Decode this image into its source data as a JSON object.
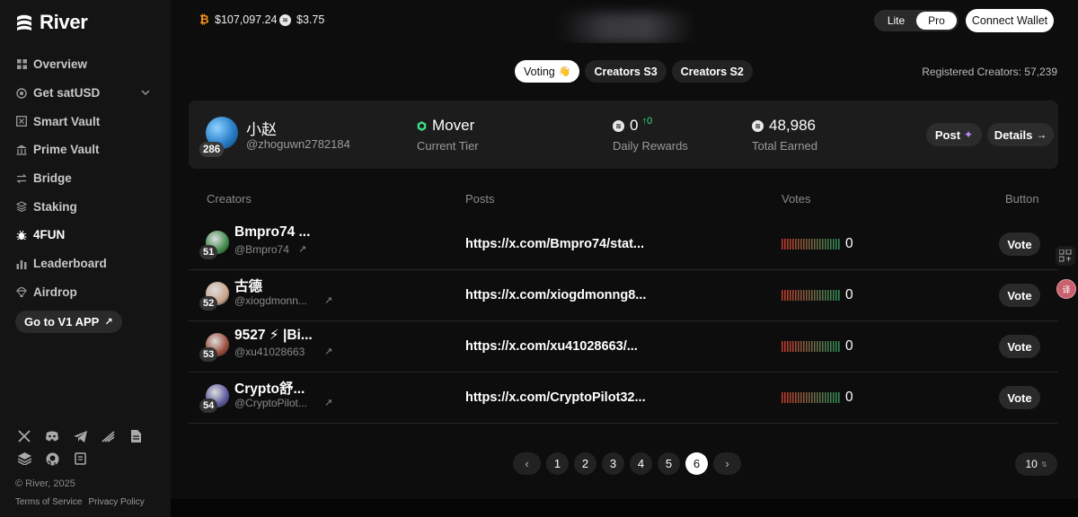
{
  "brand": {
    "name": "River"
  },
  "sidebar": {
    "items": [
      {
        "label": "Overview",
        "icon": "grid-icon",
        "active": false
      },
      {
        "label": "Get satUSD",
        "icon": "coin-icon",
        "active": false,
        "has_dropdown": true
      },
      {
        "label": "Smart Vault",
        "icon": "vault-icon",
        "active": false
      },
      {
        "label": "Prime Vault",
        "icon": "bank-icon",
        "active": false
      },
      {
        "label": "Bridge",
        "icon": "swap-icon",
        "active": false
      },
      {
        "label": "Staking",
        "icon": "stack-icon",
        "active": false
      },
      {
        "label": "4FUN",
        "icon": "bug-icon",
        "active": true
      },
      {
        "label": "Leaderboard",
        "icon": "bar-chart-icon",
        "active": false
      },
      {
        "label": "Airdrop",
        "icon": "parachute-icon",
        "active": false
      }
    ],
    "v1_button": "Go to V1 APP",
    "social_icons": [
      "x-icon",
      "discord-icon",
      "telegram-icon",
      "mirror-icon",
      "docs-icon",
      "layers-icon",
      "github-icon",
      "scroll-icon"
    ],
    "copyright": "© River, 2025",
    "terms": "Terms of Service",
    "privacy": "Privacy Policy"
  },
  "topbar": {
    "btc_price": "$107,097.24",
    "sat_price": "$3.75",
    "mode_lite": "Lite",
    "mode_pro": "Pro",
    "mode_selected": "Pro",
    "connect_wallet": "Connect Wallet"
  },
  "tabs": [
    {
      "label": "Voting",
      "emoji": "👋",
      "active": true
    },
    {
      "label": "Creators S3",
      "active": false
    },
    {
      "label": "Creators S2",
      "active": false
    }
  ],
  "registered": "Registered Creators: 57,239",
  "profile": {
    "name": "小赵",
    "handle": "@zhoguwn2782184",
    "rank": "286",
    "tier": "Mover",
    "tier_label": "Current Tier",
    "daily_rewards": "0",
    "daily_delta": "↑0",
    "daily_label": "Daily Rewards",
    "total_earned": "48,986",
    "total_label": "Total Earned",
    "post_button": "Post",
    "details_button": "Details"
  },
  "table": {
    "headers": {
      "creators": "Creators",
      "posts": "Posts",
      "votes": "Votes",
      "button": "Button"
    },
    "rows": [
      {
        "rank": "51",
        "name": "Bmpro74 ...",
        "handle": "@Bmpro74",
        "post": "https://x.com/Bmpro74/stat...",
        "votes": "0",
        "button": "Vote",
        "avatar_color": "#3f8a4a"
      },
      {
        "rank": "52",
        "name": "古德",
        "handle": "@xiogdmonn...",
        "post": "https://x.com/xiogdmonng8...",
        "votes": "0",
        "button": "Vote",
        "avatar_color": "#c9a48a"
      },
      {
        "rank": "53",
        "name": "9527 ⚡ |Bi...",
        "handle": "@xu41028663",
        "post": "https://x.com/xu41028663/...",
        "votes": "0",
        "button": "Vote",
        "avatar_color": "#9a4a3a"
      },
      {
        "rank": "54",
        "name": "Crypto舒...",
        "handle": "@CryptoPilot...",
        "post": "https://x.com/CryptoPilot32...",
        "votes": "0",
        "button": "Vote",
        "avatar_color": "#5a5aa0"
      }
    ]
  },
  "pagination": {
    "pages": [
      "1",
      "2",
      "3",
      "4",
      "5",
      "6"
    ],
    "current": "6",
    "prev": "‹",
    "next": "›",
    "page_size": "10"
  },
  "colors": {
    "accent_green": "#3ddc84",
    "btc_orange": "#f7931a",
    "bar_red": "#c0392b",
    "bar_green": "#2e8b57"
  }
}
